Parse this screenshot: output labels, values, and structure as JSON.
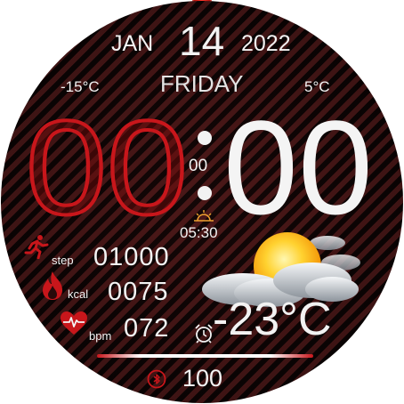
{
  "date": {
    "month": "JAN",
    "day": "14",
    "year": "2022",
    "weekday": "FRIDAY"
  },
  "weather": {
    "temp_low": "-15°C",
    "temp_high": "5°C",
    "current_temp": "-23°C",
    "icon": "partly-cloudy-icon"
  },
  "time": {
    "hours": "00",
    "minutes": "00",
    "seconds": "00"
  },
  "sunrise": {
    "time": "05:30",
    "icon": "sunrise-icon"
  },
  "activity": {
    "steps": {
      "label": "step",
      "value": "01000",
      "icon": "runner-icon"
    },
    "calories": {
      "label": "kcal",
      "value": "0075",
      "icon": "flame-icon"
    },
    "heart_rate": {
      "label": "bpm",
      "value": "072",
      "icon": "heart-icon"
    }
  },
  "alarm": {
    "icon": "alarm-clock-icon"
  },
  "battery": {
    "value": "100",
    "icon": "bluetooth-icon"
  },
  "colors": {
    "accent": "#c8161b",
    "text": "#f2f2f2",
    "background": "#1a0909"
  }
}
